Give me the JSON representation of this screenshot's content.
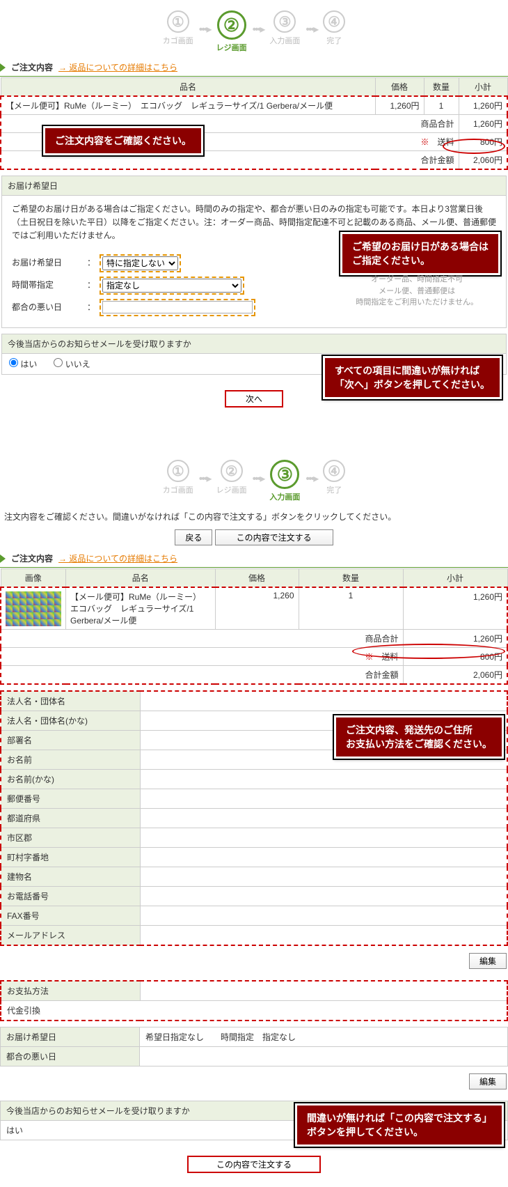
{
  "steps": {
    "s1": "カゴ画面",
    "s2": "レジ画面",
    "s3": "入力画面",
    "s4": "完了"
  },
  "section_order": "ご注文内容",
  "return_link": "→ 返品についての詳細はこちら",
  "table1": {
    "h_name": "品名",
    "h_price": "価格",
    "h_qty": "数量",
    "h_sub": "小計",
    "item_name": "【メール便可】RuMe（ルーミー）　エコバッグ　レギュラーサイズ/1 Gerbera/メール便",
    "item_price": "1,260円",
    "item_qty": "1",
    "item_sub": "1,260円",
    "subtotal_label": "商品合計",
    "subtotal": "1,260円",
    "shipping_label": "送料",
    "shipping": "800円",
    "total_label": "合計金額",
    "total": "2,060円",
    "asterisk": "※"
  },
  "callout1": "ご注文内容をご確認ください。",
  "delivery": {
    "title": "お届け希望日",
    "text": "ご希望のお届け日がある場合はご指定ください。時間のみの指定や、都合が悪い日のみの指定も可能です。本日より3営業日後（土日祝日を除いた平日）以降をご指定ください。注：オーダー商品、時間指定配達不可と記載のある商品、メール便、普通郵便ではご利用いただけません。",
    "f1_label": "お届け希望日",
    "f1_value": "特に指定しない",
    "f2_label": "時間帯指定",
    "f2_value": "指定なし",
    "f3_label": "都合の悪い日",
    "note1": "オーダー品、時間指定不可",
    "note2": "メール便、普通郵便は",
    "note3": "時間指定をご利用いただけません。"
  },
  "callout2": "ご希望のお届け日がある場合は\nご指定ください。",
  "newsletter": {
    "title": "今後当店からのお知らせメールを受け取りますか",
    "yes": "はい",
    "no": "いいえ"
  },
  "callout3": "すべての項目に間違いが無ければ\n「次へ」ボタンを押してください。",
  "btn_next": "次へ",
  "instruct3": "注文内容をご確認ください。間違いがなければ「この内容で注文する」ボタンをクリックしてください。",
  "btn_back": "戻る",
  "btn_order": "この内容で注文する",
  "table2": {
    "h_img": "画像",
    "h_name": "品名",
    "h_price": "価格",
    "h_qty": "数量",
    "h_sub": "小計",
    "item_name": "【メール便可】RuMe（ルーミー）　エコバッグ　レギュラーサイズ/1 Gerbera/メール便",
    "item_price": "1,260",
    "item_qty": "1",
    "item_sub": "1,260円",
    "subtotal_label": "商品合計",
    "subtotal": "1,260円",
    "shipping_label": "送料",
    "shipping": "800円",
    "total_label": "合計金額",
    "total": "2,060円"
  },
  "addr": {
    "f1": "法人名・団体名",
    "f2": "法人名・団体名(かな)",
    "f3": "部署名",
    "f4": "お名前",
    "f5": "お名前(かな)",
    "f6": "郵便番号",
    "f7": "都道府県",
    "f8": "市区郡",
    "f9": "町村字番地",
    "f10": "建物名",
    "f11": "お電話番号",
    "f12": "FAX番号",
    "f13": "メールアドレス"
  },
  "callout4": "ご注文内容、発送先のご住所\nお支払い方法をご確認ください。",
  "btn_edit": "編集",
  "payment": {
    "label": "お支払方法",
    "value": "代金引換"
  },
  "deliv2": {
    "label": "お届け希望日",
    "value": "希望日指定なし　　時間指定　指定なし",
    "bad_label": "都合の悪い日"
  },
  "news2": {
    "label": "今後当店からのお知らせメールを受け取りますか",
    "value": "はい"
  },
  "callout5": "間違いが無ければ「この内容で注文する」\nボタンを押してください。",
  "btn_order2": "この内容で注文する"
}
